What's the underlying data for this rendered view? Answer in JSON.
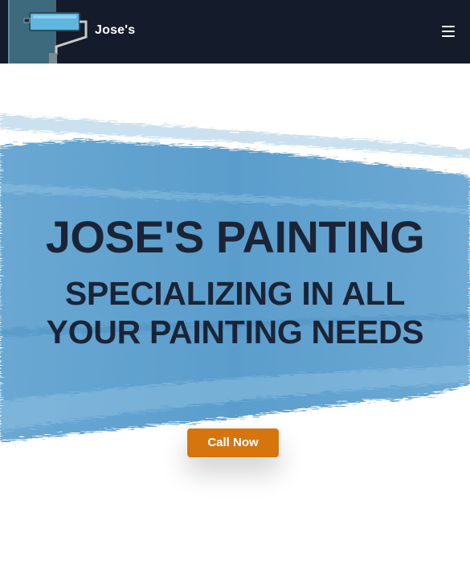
{
  "header": {
    "brand": "Jose's",
    "logo_icon": "paint-roller-icon",
    "menu_icon": "hamburger-menu-icon"
  },
  "hero": {
    "title": "JOSE'S PAINTING",
    "subtitle": "SPECIALIZING IN ALL YOUR PAINTING NEEDS",
    "cta_label": "Call Now"
  },
  "colors": {
    "header_bg": "#141b2b",
    "brush_stroke": "#5b9fcd",
    "heading_text": "#1b2436",
    "cta_bg": "#d6740e",
    "logo_accent": "#5fb6df"
  }
}
